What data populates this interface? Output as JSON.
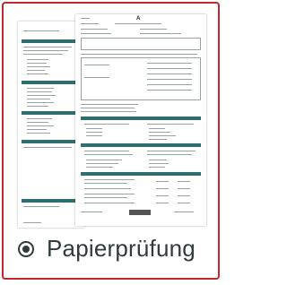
{
  "option": {
    "label": "Papierprüfung",
    "selected": true
  },
  "thumbnail": {
    "page_letter": "A"
  },
  "colors": {
    "border_accent": "#c4262e",
    "form_bar": "#2e6e6e",
    "text": "#2f3b3e"
  }
}
